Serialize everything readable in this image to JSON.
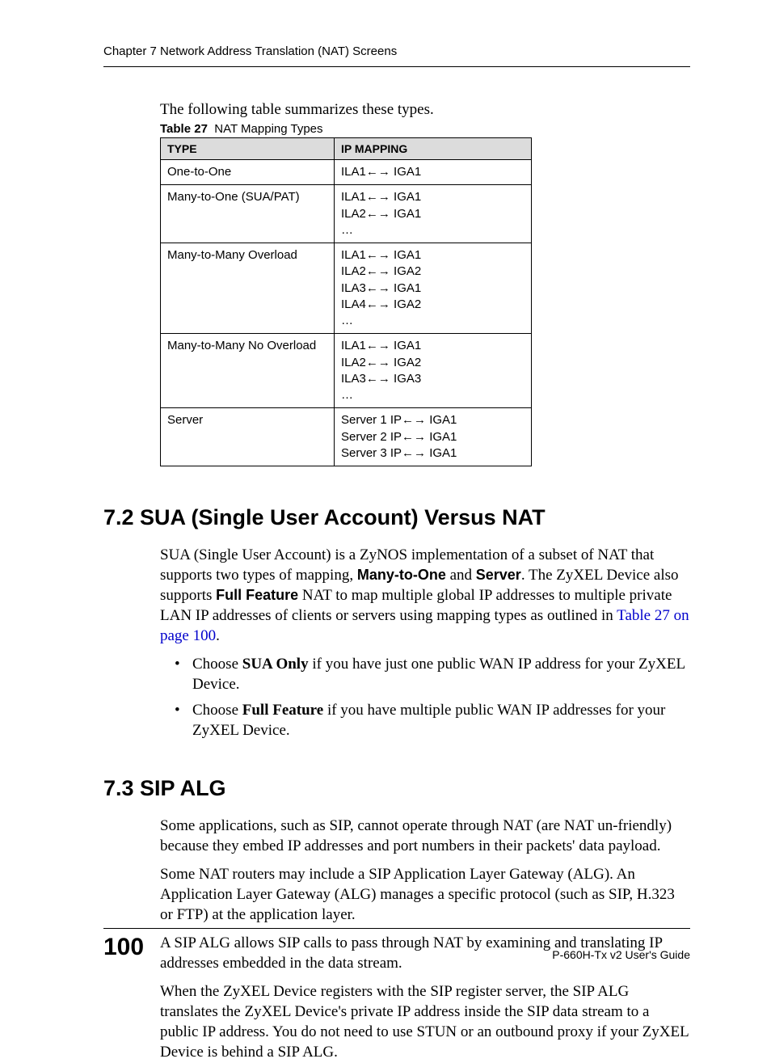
{
  "header": {
    "text": "Chapter 7 Network Address Translation (NAT) Screens"
  },
  "intro": "The following table summarizes these types.",
  "table": {
    "caption_label": "Table 27",
    "caption_text": "NAT Mapping Types",
    "head": {
      "c1": "TYPE",
      "c2": "IP MAPPING"
    },
    "rows": [
      {
        "type": "One-to-One",
        "map": "ILA1←→ IGA1"
      },
      {
        "type": "Many-to-One (SUA/PAT)",
        "map": "ILA1←→ IGA1\nILA2←→ IGA1\n…"
      },
      {
        "type": "Many-to-Many Overload",
        "map": "ILA1←→ IGA1\nILA2←→ IGA2\nILA3←→ IGA1\nILA4←→ IGA2\n…"
      },
      {
        "type": "Many-to-Many No Overload",
        "map": "ILA1←→ IGA1\nILA2←→ IGA2\nILA3←→ IGA3\n…"
      },
      {
        "type": "Server",
        "map": "Server 1 IP←→ IGA1\nServer 2 IP←→ IGA1\nServer 3 IP←→ IGA1"
      }
    ]
  },
  "s72": {
    "heading": "7.2  SUA (Single User Account) Versus NAT",
    "p1a": "SUA (Single User Account) is a ZyNOS implementation of a subset of NAT that supports two types of mapping, ",
    "b1": "Many-to-One",
    "p1b": " and ",
    "b2": "Server",
    "p1c": ". The ZyXEL Device also supports ",
    "b3": "Full Feature",
    "p1d": " NAT to map multiple global IP addresses to multiple private LAN IP addresses of clients or servers using mapping types as outlined in ",
    "xref": "Table 27 on page 100",
    "p1e": ".",
    "li1a": "Choose ",
    "li1b": "SUA Only",
    "li1c": " if you have just one public WAN IP address for your ZyXEL Device.",
    "li2a": "Choose ",
    "li2b": "Full Feature",
    "li2c": " if you have multiple public WAN IP addresses for your ZyXEL Device."
  },
  "s73": {
    "heading": "7.3  SIP ALG",
    "p1": "Some applications, such as SIP, cannot operate through NAT (are NAT un-friendly) because they embed IP addresses and port numbers in their packets' data payload.",
    "p2": "Some NAT routers may include a SIP Application Layer Gateway (ALG). An Application Layer Gateway (ALG) manages a specific protocol (such as SIP, H.323 or FTP) at the application layer.",
    "p3": "A SIP ALG allows SIP calls to pass through NAT by examining and translating IP addresses embedded in the data stream.",
    "p4": "When the ZyXEL Device registers with the SIP register server, the SIP ALG translates the ZyXEL Device's private IP address inside the SIP data stream to a public IP address. You do not need to use STUN or an outbound proxy if your ZyXEL Device is behind a SIP ALG."
  },
  "footer": {
    "page": "100",
    "guide": "P-660H-Tx v2 User's Guide"
  }
}
